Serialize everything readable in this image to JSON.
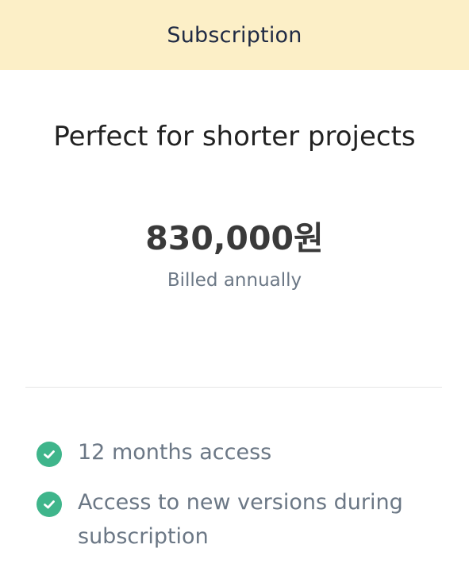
{
  "header": {
    "title": "Subscription"
  },
  "plan": {
    "tagline": "Perfect for shorter projects",
    "price": "830,000원",
    "billing": "Billed annually"
  },
  "features": [
    {
      "icon": "check-circle-icon",
      "text": "12 months access"
    },
    {
      "icon": "check-circle-icon",
      "text": "Access to new versions during subscription"
    }
  ],
  "colors": {
    "header_bg": "#fcefc7",
    "check": "#3fb58b",
    "muted_text": "#6b7785"
  }
}
